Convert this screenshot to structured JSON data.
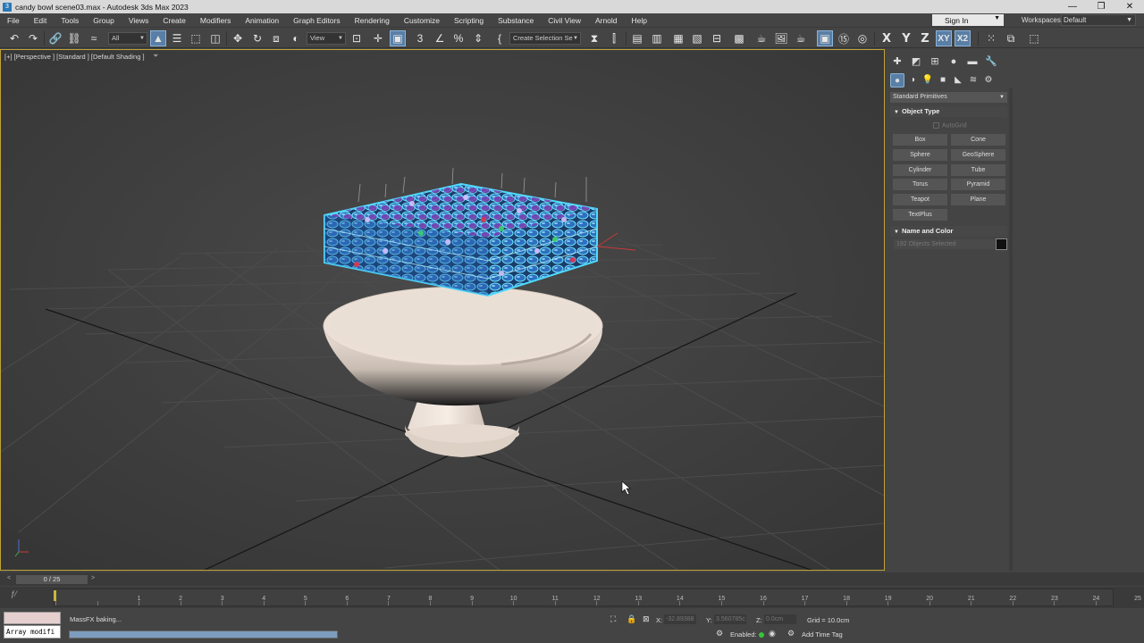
{
  "window": {
    "title": "candy bowl scene03.max - Autodesk 3ds Max 2023",
    "icon_text": "3",
    "controls": [
      "—",
      "❐",
      "✕"
    ]
  },
  "menu": [
    "File",
    "Edit",
    "Tools",
    "Group",
    "Views",
    "Create",
    "Modifiers",
    "Animation",
    "Graph Editors",
    "Rendering",
    "Customize",
    "Scripting",
    "Substance",
    "Civil View",
    "Arnold",
    "Help"
  ],
  "account": {
    "sign_in": "Sign In",
    "workspaces_label": "Workspaces:",
    "workspace": "Default"
  },
  "toolbar": {
    "selection_filter": "All",
    "ref_coord": "View",
    "named_selection_placeholder": "Create Selection Se",
    "axis_x": "X",
    "axis_y": "Y",
    "axis_z": "Z",
    "axis_xy": "XY",
    "axis_xy2": "X2"
  },
  "viewport": {
    "label": "[+] [Perspective ] [Standard ] [Default Shading ]",
    "filter_icon": "funnel-icon"
  },
  "command_panel": {
    "category": "Standard Primitives",
    "object_type_header": "Object Type",
    "autogrid": "AutoGrid",
    "buttons": [
      "Box",
      "Cone",
      "Sphere",
      "GeoSphere",
      "Cylinder",
      "Tube",
      "Torus",
      "Pyramid",
      "Teapot",
      "Plane",
      "TextPlus"
    ],
    "name_color_header": "Name and Color",
    "name_field": "192 Objects Selected",
    "swatch_color": "#111111"
  },
  "time_slider": {
    "frame_readout": "0 / 25",
    "left": "<",
    "right": ">"
  },
  "track_bar": {
    "ticks": [
      "0",
      "1",
      "2",
      "3",
      "4",
      "5",
      "6",
      "7",
      "8",
      "9",
      "10",
      "11",
      "12",
      "13",
      "14",
      "15",
      "16",
      "17",
      "18",
      "19",
      "20",
      "21",
      "22",
      "23",
      "24",
      "25"
    ]
  },
  "status": {
    "listener_text": "Array modifi",
    "message": "MassFX baking...",
    "progress": 1.0,
    "x_label": "X:",
    "x_value": "-32.89388",
    "y_label": "Y:",
    "y_value": "3.560785c",
    "z_label": "Z:",
    "z_value": "0.0cm",
    "grid": "Grid = 10.0cm",
    "enabled_label": "Enabled:",
    "time_tag": "Add Time Tag"
  },
  "colors": {
    "viewport_border": "#bfa33a",
    "selection_highlight": "#5a7fa6",
    "candy_outline": "#4fd9ff",
    "bowl": "#ece0d6"
  }
}
